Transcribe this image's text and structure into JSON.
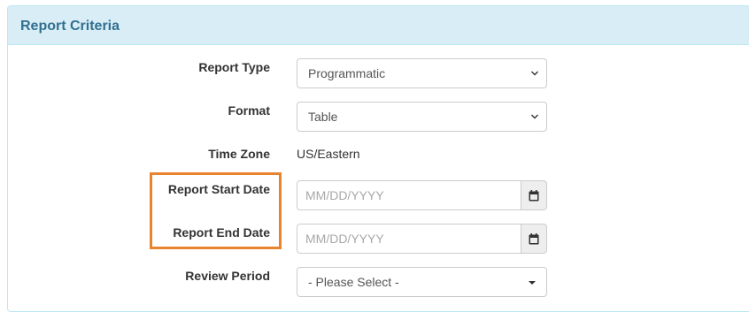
{
  "panel": {
    "title": "Report Criteria"
  },
  "form": {
    "report_type": {
      "label": "Report Type",
      "selected": "Programmatic"
    },
    "format": {
      "label": "Format",
      "selected": "Table"
    },
    "time_zone": {
      "label": "Time Zone",
      "value": "US/Eastern"
    },
    "start_date": {
      "label": "Report Start Date",
      "value": "",
      "placeholder": "MM/DD/YYYY"
    },
    "end_date": {
      "label": "Report End Date",
      "value": "",
      "placeholder": "MM/DD/YYYY"
    },
    "review_period": {
      "label": "Review Period",
      "selected": "- Please Select -"
    }
  },
  "icons": {
    "select_arrow": "chevron-down-icon",
    "dropdown_caret": "caret-down-icon",
    "calendar": "calendar-icon"
  },
  "colors": {
    "panel_heading_bg": "#d9edf7",
    "panel_title": "#31708f",
    "panel_border": "#bce8f1",
    "highlight_border": "#e8832e"
  }
}
